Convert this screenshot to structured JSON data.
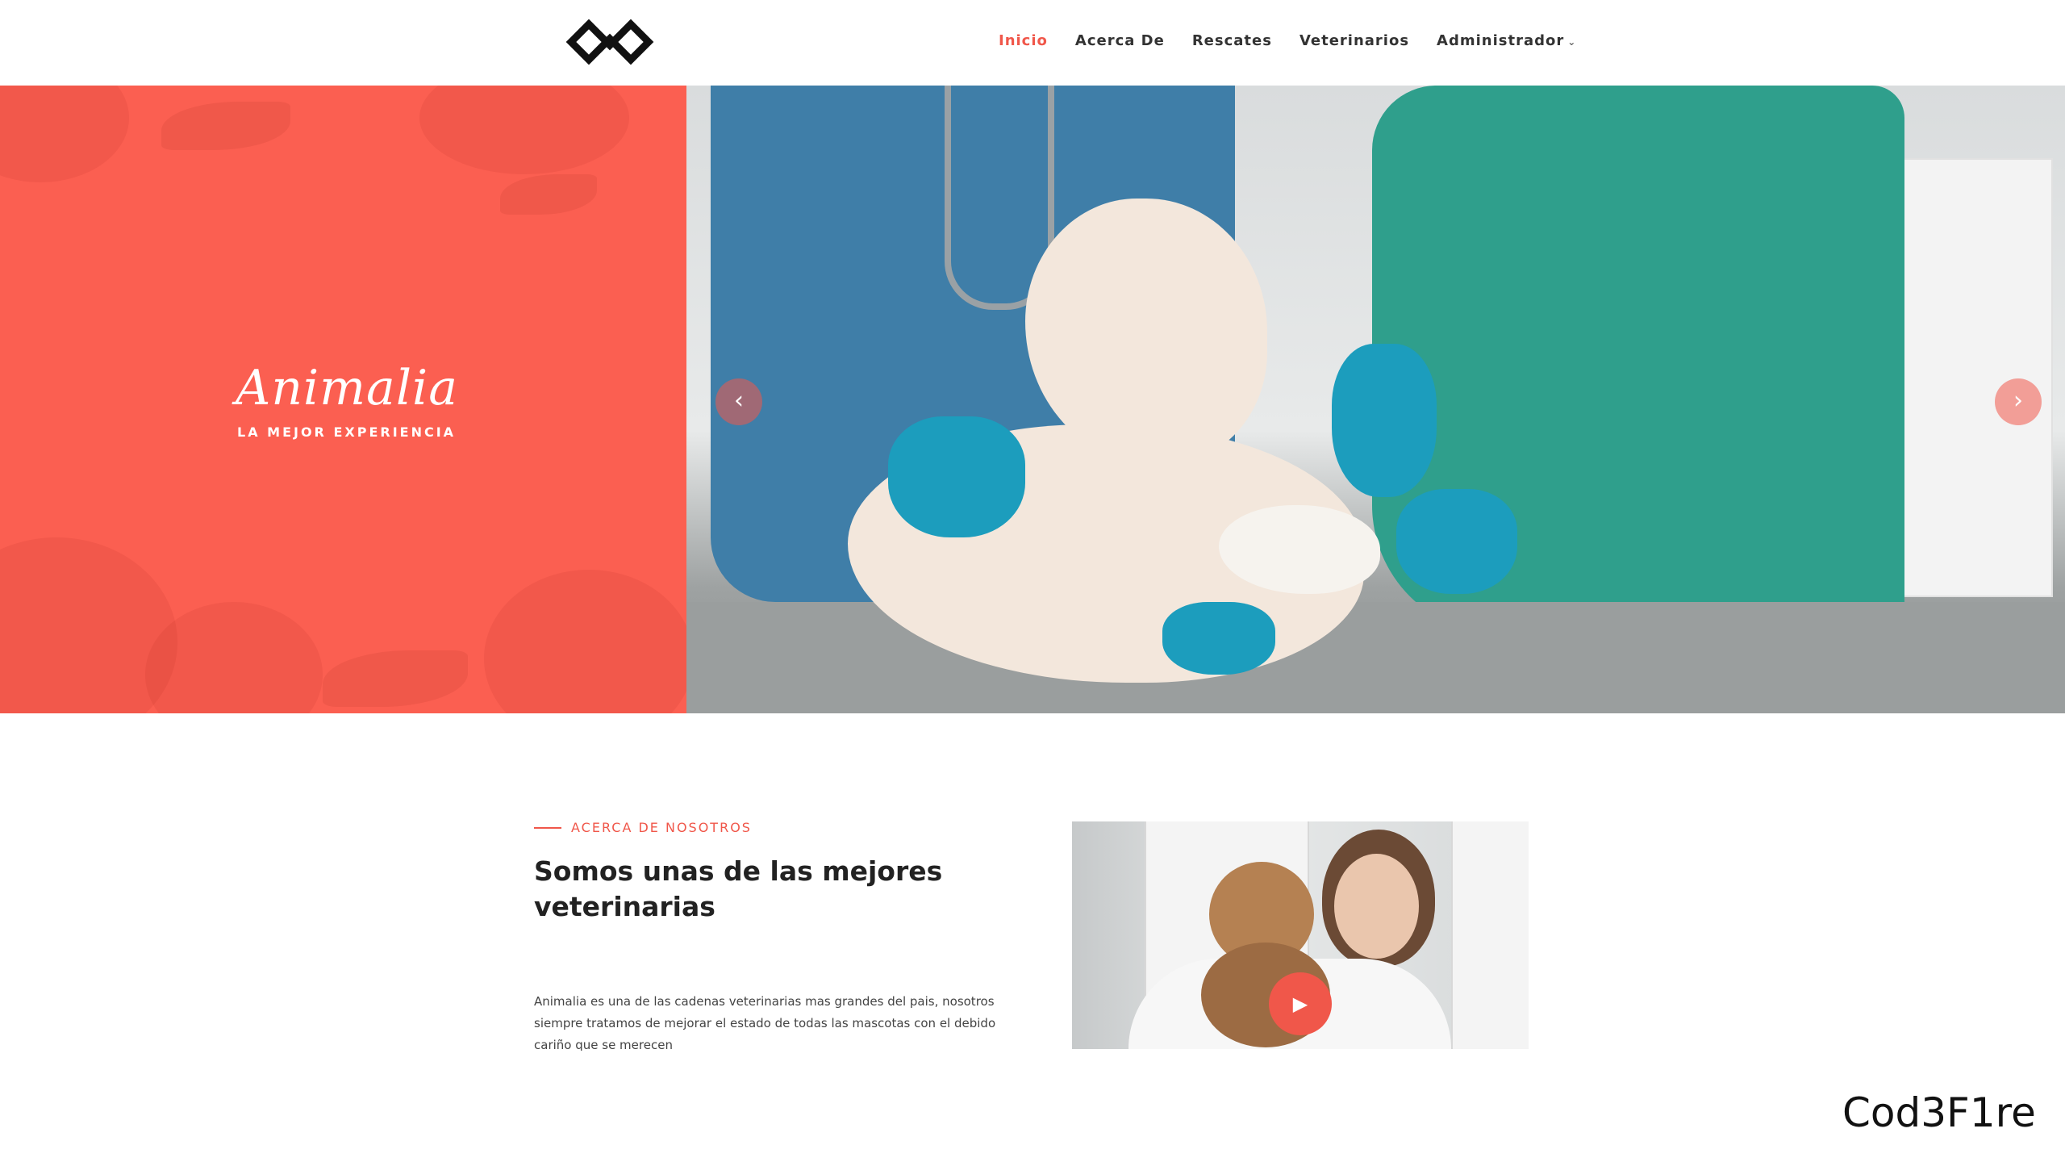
{
  "nav": {
    "items": [
      {
        "label": "Inicio",
        "active": true
      },
      {
        "label": "Acerca De",
        "active": false
      },
      {
        "label": "Rescates",
        "active": false
      },
      {
        "label": "Veterinarios",
        "active": false
      },
      {
        "label": "Administrador",
        "active": false,
        "dropdown": true
      }
    ],
    "dropdown_icon": "chevron-down-icon"
  },
  "hero": {
    "brand": "Animalia",
    "tagline": "LA MEJOR EXPERIENCIA",
    "prev_icon": "chevron-left-icon",
    "next_icon": "chevron-right-icon"
  },
  "about": {
    "kicker": "ACERCA DE NOSOTROS",
    "title": "Somos unas de las mejores veterinarias",
    "body": "Animalia es una de las cadenas veterinarias mas grandes del pais, nosotros siempre tratamos de mejorar el estado de todas las mascotas con el debido cariño que se merecen",
    "play_icon": "play-icon"
  },
  "watermark": "Cod3F1re",
  "colors": {
    "accent": "#f0574a",
    "hero_panel": "#fb5f51",
    "text_dark": "#222222"
  }
}
